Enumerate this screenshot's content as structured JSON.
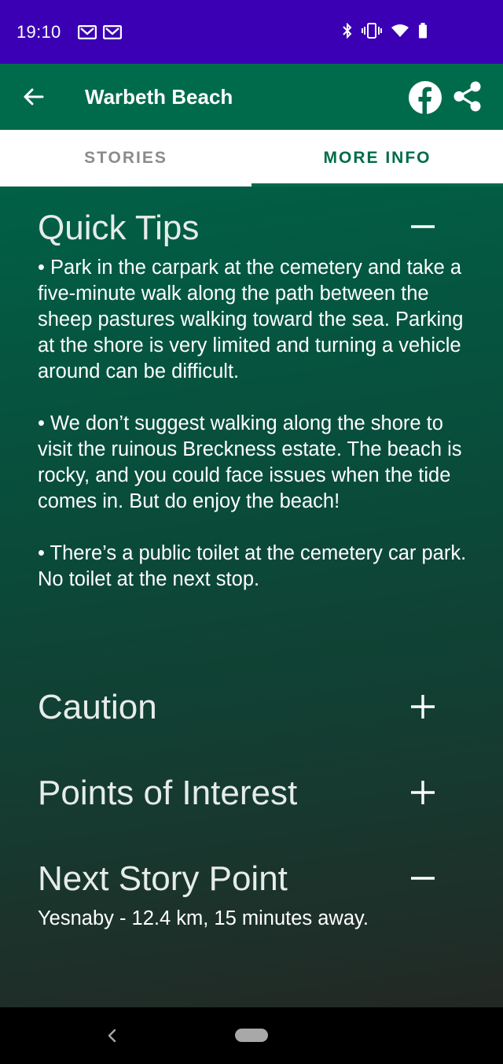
{
  "status_bar": {
    "time": "19:10",
    "icons": [
      "gmail-icon",
      "gmail-icon",
      "bluetooth-icon",
      "vibrate-icon",
      "wifi-icon",
      "battery-icon"
    ]
  },
  "app_bar": {
    "title": "Warbeth Beach",
    "back_icon": "arrow-back-icon",
    "facebook_icon": "facebook-icon",
    "share_icon": "share-icon"
  },
  "tabs": [
    {
      "label": "STORIES",
      "selected": false
    },
    {
      "label": "MORE INFO",
      "selected": true
    }
  ],
  "sections": {
    "quick_tips": {
      "title": "Quick Tips",
      "expanded": true,
      "bullets": [
        "• Park in the carpark at the cemetery and take a five-minute walk along the path between the sheep pastures walking toward the sea. Parking at the shore is very limited and turning a vehicle around can be difficult.",
        "• We don’t suggest walking along the shore to visit the ruinous Breckness estate. The beach is rocky, and you could face issues when the tide comes in. But do enjoy the beach!",
        "• There’s a public toilet at the cemetery car park. No toilet at the next stop."
      ]
    },
    "caution": {
      "title": "Caution",
      "expanded": false
    },
    "points_of_interest": {
      "title": "Points of Interest",
      "expanded": false
    },
    "next_story_point": {
      "title": "Next Story Point",
      "expanded": true,
      "text": "Yesnaby - 12.4 km, 15 minutes away."
    }
  },
  "colors": {
    "status_bar": "#3b00b4",
    "app_bar": "#006b4b",
    "accent": "#006b4b",
    "tab_inactive": "#8b8b8b"
  }
}
